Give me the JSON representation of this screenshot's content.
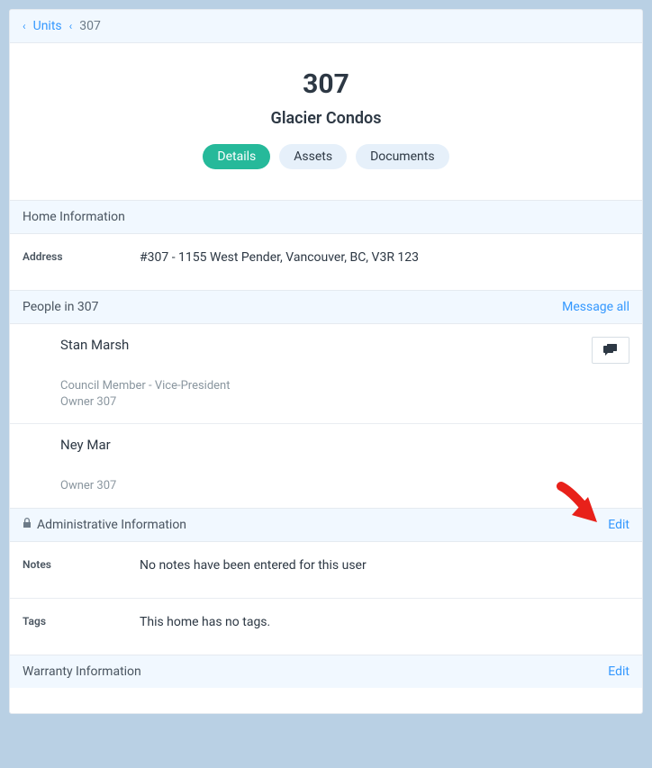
{
  "breadcrumb": {
    "root": "Units",
    "current": "307"
  },
  "header": {
    "unit_number": "307",
    "building_name": "Glacier Condos"
  },
  "tabs": {
    "details": "Details",
    "assets": "Assets",
    "documents": "Documents"
  },
  "home_info": {
    "title": "Home Information",
    "address_label": "Address",
    "address_value": "#307 - 1155 West Pender, Vancouver, BC, V3R 123"
  },
  "people": {
    "title": "People in 307",
    "message_all": "Message all",
    "list": [
      {
        "name": "Stan Marsh",
        "role1": "Council Member - Vice-President",
        "role2": "Owner 307",
        "has_msg_button": true
      },
      {
        "name": "Ney Mar",
        "role1": "",
        "role2": "Owner 307",
        "has_msg_button": false
      }
    ]
  },
  "admin": {
    "title": "Administrative Information",
    "edit": "Edit",
    "notes_label": "Notes",
    "notes_value": "No notes have been entered for this user",
    "tags_label": "Tags",
    "tags_value": "This home has no tags."
  },
  "warranty": {
    "title": "Warranty Information",
    "edit": "Edit"
  }
}
